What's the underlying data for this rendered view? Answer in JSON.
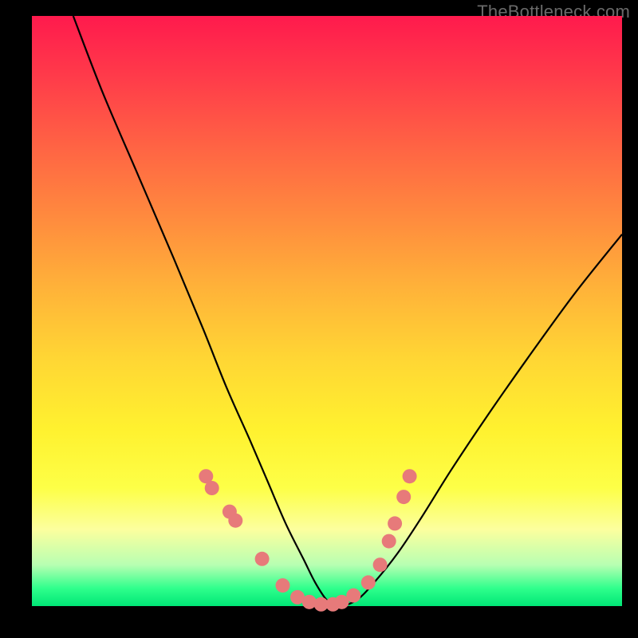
{
  "watermark": "TheBottleneck.com",
  "colors": {
    "background": "#000000",
    "curve": "#000000",
    "dots": "#e77a7a",
    "gradient_top": "#ff1a4d",
    "gradient_mid": "#ffd634",
    "gradient_bottom": "#00e676"
  },
  "chart_data": {
    "type": "line",
    "title": "",
    "xlabel": "",
    "ylabel": "",
    "xlim": [
      0,
      100
    ],
    "ylim": [
      0,
      100
    ],
    "series": [
      {
        "name": "bottleneck-curve",
        "x": [
          7,
          12,
          18,
          24,
          29,
          33,
          37,
          40,
          43,
          46,
          48,
          50,
          52,
          55,
          58,
          62,
          66,
          71,
          77,
          84,
          92,
          100
        ],
        "y": [
          100,
          87,
          73,
          59,
          47,
          37,
          28,
          21,
          14,
          8,
          4,
          1,
          0,
          1,
          4,
          9,
          15,
          23,
          32,
          42,
          53,
          63
        ]
      }
    ],
    "markers": {
      "name": "highlighted-points",
      "x": [
        29.5,
        30.5,
        33.5,
        34.5,
        39.0,
        42.5,
        45.0,
        47.0,
        49.0,
        51.0,
        52.5,
        54.5,
        57.0,
        59.0,
        60.5,
        61.5,
        63.0,
        64.0
      ],
      "y": [
        22.0,
        20.0,
        16.0,
        14.5,
        8.0,
        3.5,
        1.5,
        0.7,
        0.3,
        0.3,
        0.7,
        1.8,
        4.0,
        7.0,
        11.0,
        14.0,
        18.5,
        22.0
      ],
      "size": 9
    }
  }
}
